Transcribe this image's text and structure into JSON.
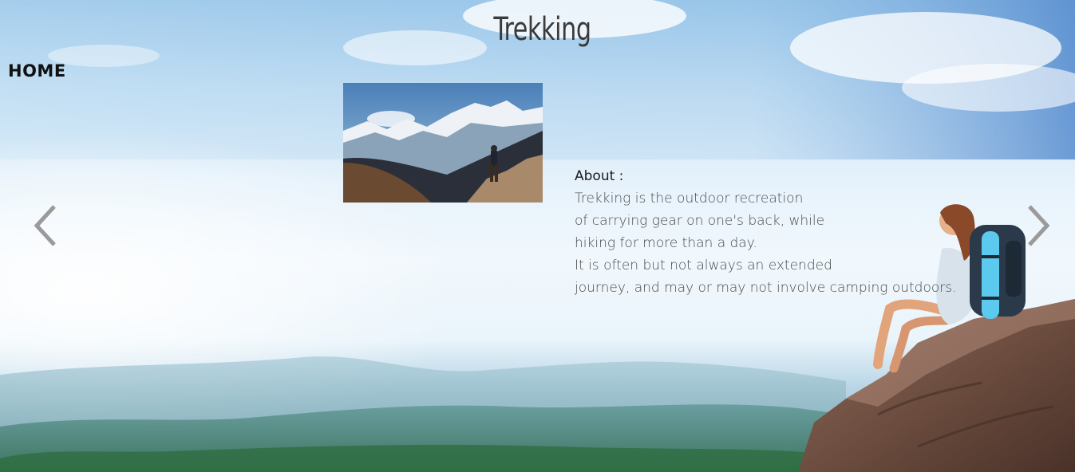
{
  "page": {
    "title": "Trekking",
    "nav": {
      "home_label": "HOME"
    }
  },
  "about": {
    "heading": "About :",
    "lines": [
      "Trekking is the outdoor recreation",
      "of carrying gear on one's back, while",
      "hiking for more than a day.",
      "It is often but not always an extended",
      "journey, and may or may not involve camping outdoors."
    ]
  },
  "carousel": {
    "prev_icon": "chevron-left-icon",
    "next_icon": "chevron-right-icon"
  },
  "colors": {
    "title": "#3a3a3a",
    "nav": "#111111",
    "about_text": "#4a4a4a",
    "arrow": "#9a9a9a"
  }
}
